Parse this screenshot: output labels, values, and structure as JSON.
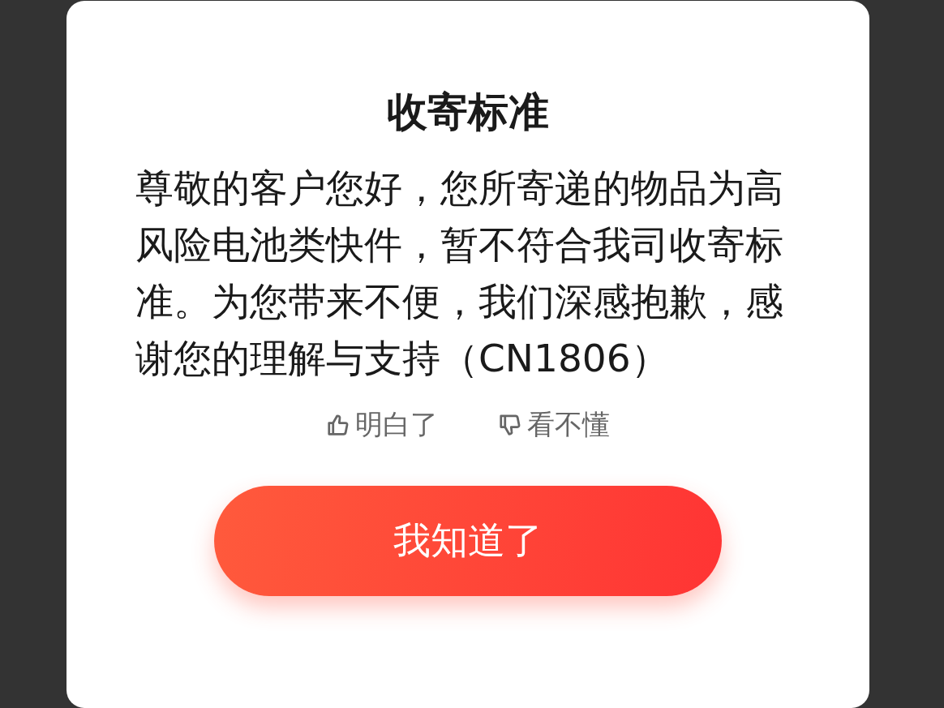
{
  "dialog": {
    "title": "收寄标准",
    "message": "尊敬的客户您好，您所寄递的物品为高风险电池类快件，暂不符合我司收寄标准。为您带来不便，我们深感抱歉，感谢您的理解与支持（CN1806）",
    "feedback": [
      {
        "kind": "up",
        "label": "明白了"
      },
      {
        "kind": "down",
        "label": "看不懂"
      }
    ],
    "button": "我知道了"
  }
}
